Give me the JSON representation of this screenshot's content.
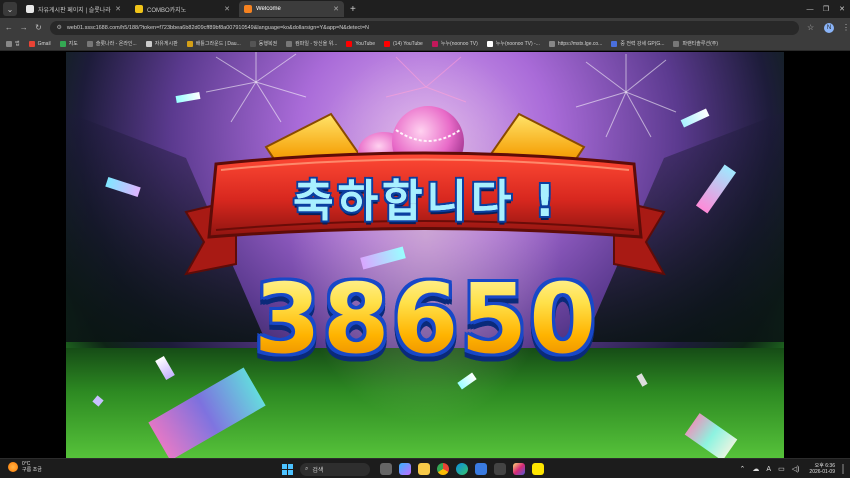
{
  "browser": {
    "tabs": [
      {
        "title": "자유게시판 페이지 | 슬롯나라",
        "favicon_color": "#e8e8e8",
        "active": false
      },
      {
        "title": "COMBO카지노",
        "favicon_color": "#f0c419",
        "active": false
      },
      {
        "title": "Welcome",
        "favicon_color": "#f58220",
        "active": true
      }
    ],
    "new_tab_symbol": "+",
    "url": "web01.sssc1688.com/h5/188/?token=f723bbea6b82d09cff89bf8a007910549&language=ko&dollarsign=Y&app=N&detect=N",
    "profile_initial": "N",
    "bookmarks": [
      {
        "label": "앱",
        "color": "#888"
      },
      {
        "label": "Gmail",
        "color": "#ea4335"
      },
      {
        "label": "지도",
        "color": "#34a853"
      },
      {
        "label": "슬롯나라 - 온라인...",
        "color": "#777"
      },
      {
        "label": "자유게시판",
        "color": "#cccccc"
      },
      {
        "label": "배틀그라운드 | Dau...",
        "color": "#d4a017"
      },
      {
        "label": "동행복권",
        "color": "#555"
      },
      {
        "label": "컴파일 - 당신을 위...",
        "color": "#777"
      },
      {
        "label": "YouTube",
        "color": "#ff0000"
      },
      {
        "label": "(14) YouTube",
        "color": "#ff0000"
      },
      {
        "label": "누누(noonoo TV)",
        "color": "#c2185b"
      },
      {
        "label": "누누(noonoo TV) -...",
        "color": "#ffffff"
      },
      {
        "label": "https://mstx.lge.co...",
        "color": "#888"
      },
      {
        "label": "중 전력 강세 GP(G...",
        "color": "#4a6fdc"
      },
      {
        "label": "파랜티솔루션(주)",
        "color": "#777"
      }
    ]
  },
  "game": {
    "banner_text": "축하합니다 !",
    "win_amount": "38650",
    "colors": {
      "banner_red": "#d8281f",
      "text_cyan": "#a8f0ff",
      "gold": "#ffd21a",
      "outline_blue": "#1848c8"
    }
  },
  "taskbar": {
    "weather_temp": "0°C",
    "weather_desc": "구름 조금",
    "search_label": "검색",
    "time": "오후 6:36",
    "date": "2026-01-09",
    "tray_lang": "A"
  }
}
